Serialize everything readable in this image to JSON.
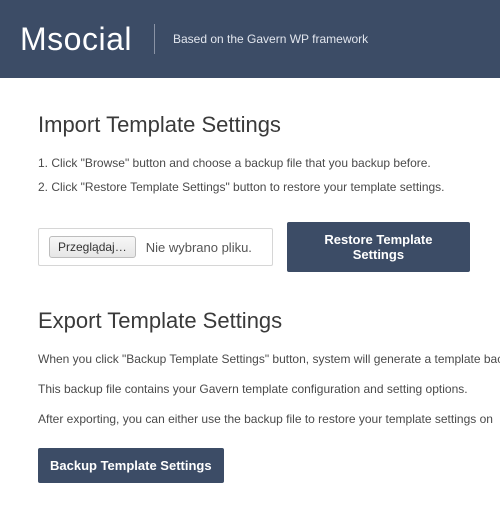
{
  "header": {
    "brand": "Msocial",
    "tagline": "Based on the Gavern WP framework"
  },
  "import": {
    "title": "Import Template Settings",
    "steps": [
      "1. Click \"Browse\" button and choose a backup file that you backup before.",
      "2. Click \"Restore Template Settings\" button to restore your template settings."
    ],
    "browse_label": "Przeglądaj…",
    "file_status": "Nie wybrano pliku.",
    "restore_label": "Restore Template Settings"
  },
  "export": {
    "title": "Export Template Settings",
    "paragraphs": [
      "When you click \"Backup Template Settings\" button, system will generate a template backup file.",
      "This backup file contains your Gavern template configuration and setting options.",
      "After exporting, you can either use the backup file to restore your template settings on"
    ],
    "backup_label": "Backup Template Settings"
  }
}
